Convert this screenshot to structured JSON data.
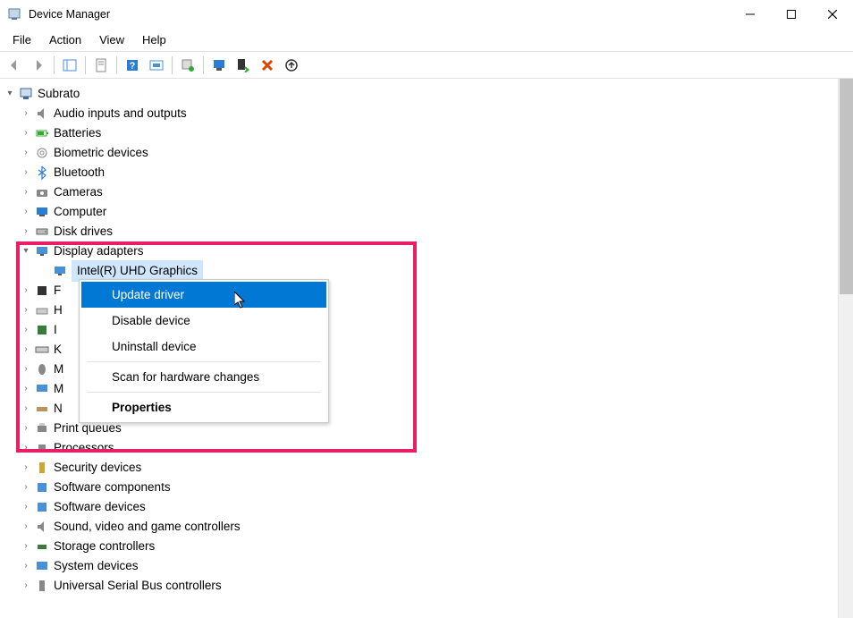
{
  "window": {
    "title": "Device Manager"
  },
  "menus": {
    "file": "File",
    "action": "Action",
    "view": "View",
    "help": "Help"
  },
  "tree": {
    "root": "Subrato",
    "items": [
      {
        "label": "Audio inputs and outputs",
        "icon": "speaker"
      },
      {
        "label": "Batteries",
        "icon": "battery"
      },
      {
        "label": "Biometric devices",
        "icon": "fingerprint"
      },
      {
        "label": "Bluetooth",
        "icon": "bluetooth"
      },
      {
        "label": "Cameras",
        "icon": "camera"
      },
      {
        "label": "Computer",
        "icon": "computer"
      },
      {
        "label": "Disk drives",
        "icon": "disk"
      },
      {
        "label": "Display adapters",
        "icon": "display",
        "expanded": true
      },
      {
        "label": "F",
        "icon": "firmware",
        "obscured": true
      },
      {
        "label": "H",
        "icon": "hid",
        "obscured": true
      },
      {
        "label": "I",
        "icon": "imaging",
        "obscured": true
      },
      {
        "label": "K",
        "icon": "keyboard",
        "obscured": true
      },
      {
        "label": "M",
        "icon": "mouse",
        "obscured": true
      },
      {
        "label": "M",
        "icon": "monitor",
        "obscured": true
      },
      {
        "label": "N",
        "icon": "network",
        "obscured": true
      },
      {
        "label": "Print queues",
        "icon": "printer"
      },
      {
        "label": "Processors",
        "icon": "cpu"
      },
      {
        "label": "Security devices",
        "icon": "security"
      },
      {
        "label": "Software components",
        "icon": "software"
      },
      {
        "label": "Software devices",
        "icon": "software"
      },
      {
        "label": "Sound, video and game controllers",
        "icon": "sound"
      },
      {
        "label": "Storage controllers",
        "icon": "storage"
      },
      {
        "label": "System devices",
        "icon": "system"
      },
      {
        "label": "Universal Serial Bus controllers",
        "icon": "usb"
      }
    ],
    "display_adapter_child_visible": "Intel(R) UHD Graphics"
  },
  "context_menu": {
    "update": "Update driver",
    "disable": "Disable device",
    "uninstall": "Uninstall device",
    "scan": "Scan for hardware changes",
    "properties": "Properties"
  }
}
